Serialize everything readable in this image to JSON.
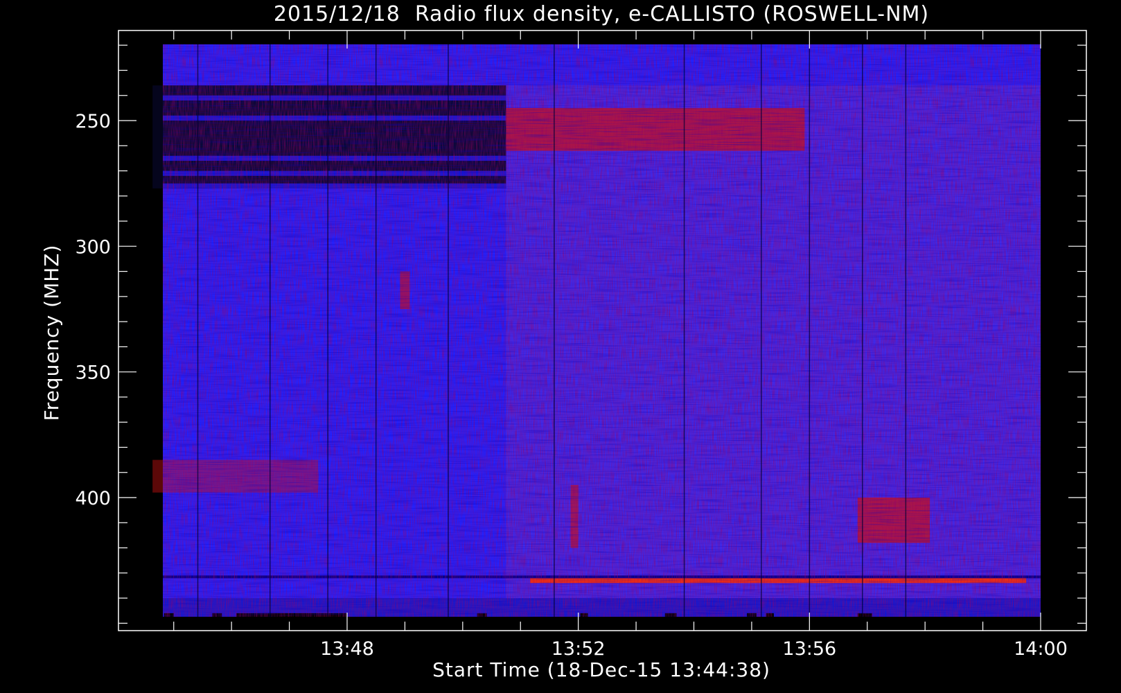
{
  "chart_data": {
    "type": "heatmap",
    "title": "2015/12/18  Radio flux density, e-CALLISTO (ROSWELL-NM)",
    "xlabel": "Start Time (18-Dec-15 13:44:38)",
    "ylabel": "Frequency (MHZ)",
    "x_unit": "time (HH:MM)",
    "xlim": [
      "13:44:38",
      "14:00:00"
    ],
    "ylim": [
      220,
      452
    ],
    "y_inverted": true,
    "x_ticks": [
      "13:48",
      "13:52",
      "13:56",
      "14:00"
    ],
    "y_ticks": [
      250,
      300,
      350,
      400
    ],
    "grid": false,
    "colors": {
      "background": "#000000",
      "low_intensity": "#2222ff",
      "mid_intensity": "#6633cc",
      "high_intensity": "#cc1111",
      "peak_intensity": "#ff3300",
      "saturated": "#ffffff"
    },
    "features": [
      {
        "t_start": "13:44:38",
        "t_end": "13:50:45",
        "f_low": 236,
        "f_high": 277,
        "level": "background-subtracted (dark)"
      },
      {
        "t_start": "13:50:45",
        "t_end": "13:55:55",
        "f_low": 245,
        "f_high": 262,
        "level": "enhanced emission"
      },
      {
        "t_start": "13:44:38",
        "t_end": "13:47:30",
        "f_low": 385,
        "f_high": 398,
        "level": "moderate emission"
      },
      {
        "t_start": "13:56:50",
        "t_end": "13:58:05",
        "f_low": 400,
        "f_high": 418,
        "level": "enhanced emission"
      },
      {
        "t_start": "13:48:55",
        "t_end": "13:49:05",
        "f_low": 310,
        "f_high": 325,
        "level": "short burst"
      },
      {
        "t_start": "13:51:52",
        "t_end": "13:52:00",
        "f_low": 395,
        "f_high": 420,
        "level": "short burst"
      },
      {
        "t_start": "13:51:10",
        "t_end": "13:59:45",
        "f_low": 432,
        "f_high": 434,
        "level": "interference line"
      }
    ]
  }
}
